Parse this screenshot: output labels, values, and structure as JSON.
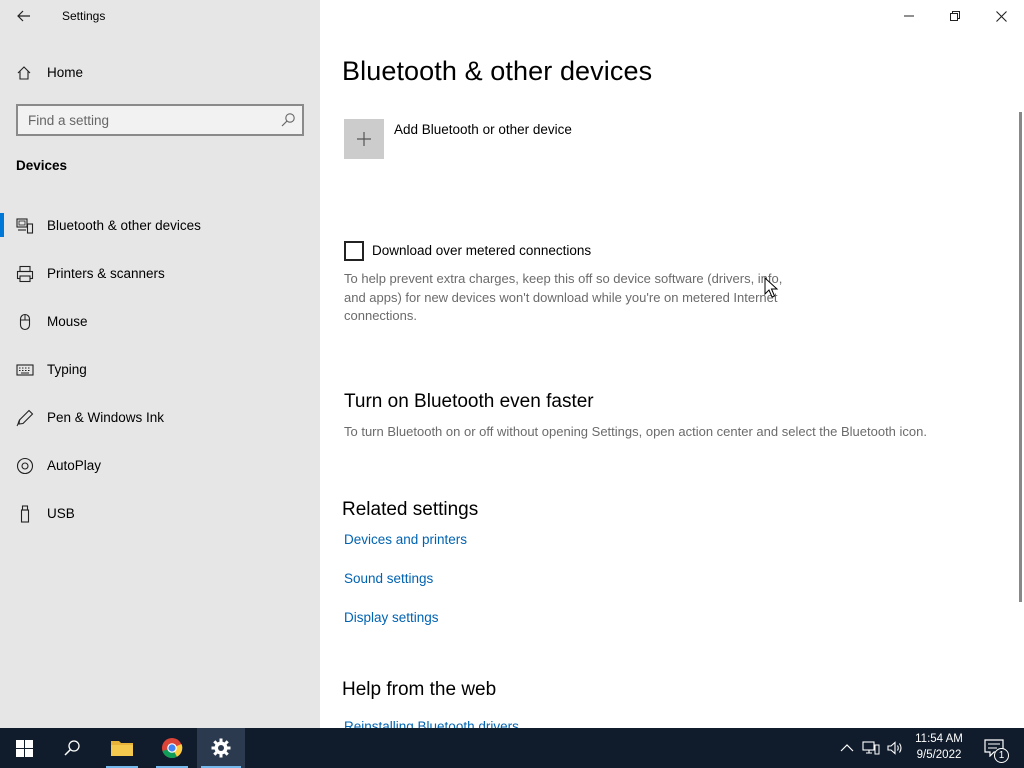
{
  "window": {
    "title": "Settings"
  },
  "sidebar": {
    "home_label": "Home",
    "search_placeholder": "Find a setting",
    "section_heading": "Devices",
    "items": [
      {
        "label": "Bluetooth & other devices",
        "icon": "bluetooth-devices-icon",
        "selected": true
      },
      {
        "label": "Printers & scanners",
        "icon": "printer-icon",
        "selected": false
      },
      {
        "label": "Mouse",
        "icon": "mouse-icon",
        "selected": false
      },
      {
        "label": "Typing",
        "icon": "keyboard-icon",
        "selected": false
      },
      {
        "label": "Pen & Windows Ink",
        "icon": "pen-icon",
        "selected": false
      },
      {
        "label": "AutoPlay",
        "icon": "autoplay-icon",
        "selected": false
      },
      {
        "label": "USB",
        "icon": "usb-icon",
        "selected": false
      }
    ]
  },
  "main": {
    "page_title": "Bluetooth & other devices",
    "add_device_label": "Add Bluetooth or other device",
    "metered": {
      "label": "Download over metered connections",
      "checked": false,
      "description": "To help prevent extra charges, keep this off so device software (drivers, info, and apps) for new devices won't download while you're on metered Internet connections."
    },
    "faster": {
      "heading": "Turn on Bluetooth even faster",
      "description": "To turn Bluetooth on or off without opening Settings, open action center and select the Bluetooth icon."
    },
    "related": {
      "heading": "Related settings",
      "links": [
        "Devices and printers",
        "Sound settings",
        "Display settings"
      ]
    },
    "help": {
      "heading": "Help from the web",
      "link": "Reinstalling Bluetooth drivers"
    }
  },
  "taskbar": {
    "time": "11:54 AM",
    "date": "9/5/2022",
    "notification_count": "1"
  },
  "colors": {
    "accent": "#0078d7",
    "link": "#0063b1",
    "sidebar_bg": "#e6e6e6",
    "taskbar_bg": "#101c2c"
  }
}
